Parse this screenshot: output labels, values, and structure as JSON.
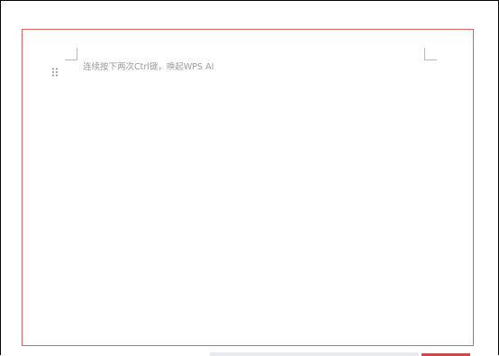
{
  "editor": {
    "placeholder_text": "连续按下两次Ctrl键，唤起WPS AI"
  },
  "icons": {
    "drag_handle": "drag-handle-icon"
  },
  "colors": {
    "page_border": "#e06060",
    "placeholder_text": "#9a9a9a",
    "corner_marks": "#b8b8b8",
    "status_accent": "#c94a4a"
  }
}
